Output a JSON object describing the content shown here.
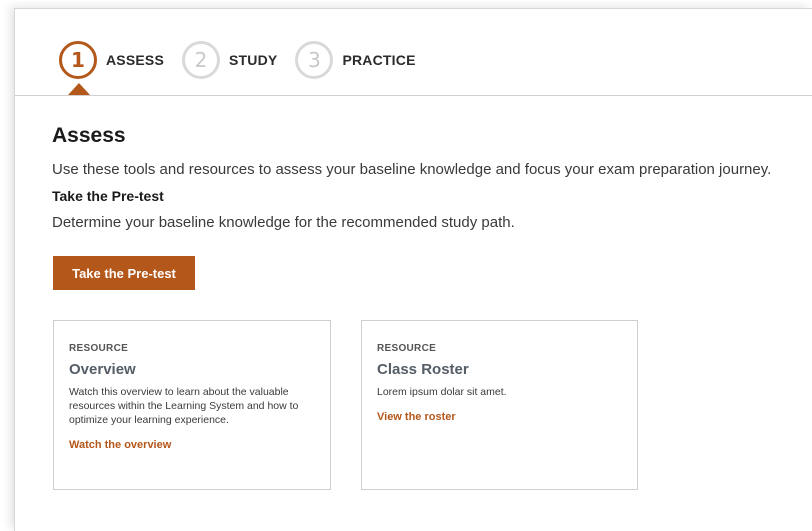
{
  "stepper": {
    "steps": [
      {
        "number": "1",
        "label": "ASSESS",
        "state": "active"
      },
      {
        "number": "2",
        "label": "STUDY",
        "state": "inactive"
      },
      {
        "number": "3",
        "label": "PRACTICE",
        "state": "inactive"
      }
    ]
  },
  "assess": {
    "title": "Assess",
    "description": "Use these tools and resources to assess your baseline knowledge and focus your exam preparation journey.",
    "pretest_heading": "Take the Pre-test",
    "pretest_description": "Determine your baseline knowledge for the recommended study path.",
    "pretest_button": "Take the Pre-test"
  },
  "resources": [
    {
      "kicker": "RESOURCE",
      "title": "Overview",
      "body": "Watch this overview to learn about the valuable resources within the Learning System and how to optimize your learning experience.",
      "link": "Watch the overview"
    },
    {
      "kicker": "RESOURCE",
      "title": "Class Roster",
      "body": "Lorem ipsum dolar sit amet.",
      "link": "View the roster"
    }
  ],
  "colors": {
    "accent": "#b4571a",
    "inactive_step": "#d9d9d9",
    "divider": "#d0d0d0",
    "card_border": "#cfcfcf"
  }
}
